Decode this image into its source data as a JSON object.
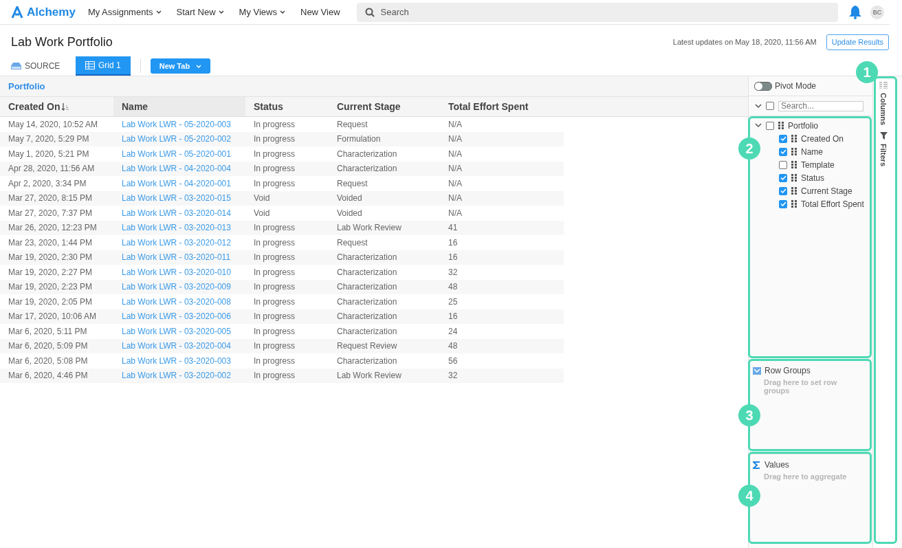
{
  "nav": {
    "logo": "Alchemy",
    "menus": [
      {
        "label": "My Assignments",
        "dropdown": true
      },
      {
        "label": "Start New",
        "dropdown": true
      },
      {
        "label": "My Views",
        "dropdown": true
      },
      {
        "label": "New View",
        "dropdown": false
      }
    ],
    "search": {
      "placeholder": "Search"
    },
    "avatar": "BC"
  },
  "page": {
    "title": "Lab Work Portfolio",
    "updated": "Latest updates on May 18, 2020, 11:56 AM",
    "update_button": "Update Results"
  },
  "tabs": [
    {
      "label": "SOURCE",
      "kind": "source",
      "selected": false
    },
    {
      "label": "Grid 1",
      "kind": "grid",
      "selected": true
    }
  ],
  "new_tab_button": "New Tab",
  "table": {
    "group": "Portfolio",
    "columns": [
      {
        "label": "Created On",
        "sorted": true
      },
      {
        "label": "Name",
        "sorted": false
      },
      {
        "label": "Status",
        "sorted": false
      },
      {
        "label": "Current Stage",
        "sorted": false
      },
      {
        "label": "Total Effort Spent",
        "sorted": false
      }
    ],
    "rows": [
      [
        "May 14, 2020, 10:52 AM",
        "Lab Work LWR - 05-2020-003",
        "In progress",
        "Request",
        "N/A"
      ],
      [
        "May 7, 2020, 5:29 PM",
        "Lab Work LWR - 05-2020-002",
        "In progress",
        "Formulation",
        "N/A"
      ],
      [
        "May 1, 2020, 5:21 PM",
        "Lab Work LWR - 05-2020-001",
        "In progress",
        "Characterization",
        "N/A"
      ],
      [
        "Apr 28, 2020, 11:56 AM",
        "Lab Work LWR - 04-2020-004",
        "In progress",
        "Characterization",
        "N/A"
      ],
      [
        "Apr 2, 2020, 3:34 PM",
        "Lab Work LWR - 04-2020-001",
        "In progress",
        "Request",
        "N/A"
      ],
      [
        "Mar 27, 2020, 8:15 PM",
        "Lab Work LWR - 03-2020-015",
        "Void",
        "Voided",
        "N/A"
      ],
      [
        "Mar 27, 2020, 7:37 PM",
        "Lab Work LWR - 03-2020-014",
        "Void",
        "Voided",
        "N/A"
      ],
      [
        "Mar 26, 2020, 12:23 PM",
        "Lab Work LWR - 03-2020-013",
        "In progress",
        "Lab Work Review",
        "41"
      ],
      [
        "Mar 23, 2020, 1:44 PM",
        "Lab Work LWR - 03-2020-012",
        "In progress",
        "Request",
        "16"
      ],
      [
        "Mar 19, 2020, 2:30 PM",
        "Lab Work LWR - 03-2020-011",
        "In progress",
        "Characterization",
        "16"
      ],
      [
        "Mar 19, 2020, 2:27 PM",
        "Lab Work LWR - 03-2020-010",
        "In progress",
        "Characterization",
        "32"
      ],
      [
        "Mar 19, 2020, 2:23 PM",
        "Lab Work LWR - 03-2020-009",
        "In progress",
        "Characterization",
        "48"
      ],
      [
        "Mar 19, 2020, 2:05 PM",
        "Lab Work LWR - 03-2020-008",
        "In progress",
        "Characterization",
        "25"
      ],
      [
        "Mar 17, 2020, 10:06 AM",
        "Lab Work LWR - 03-2020-006",
        "In progress",
        "Characterization",
        "16"
      ],
      [
        "Mar 6, 2020, 5:11 PM",
        "Lab Work LWR - 03-2020-005",
        "In progress",
        "Characterization",
        "24"
      ],
      [
        "Mar 6, 2020, 5:09 PM",
        "Lab Work LWR - 03-2020-004",
        "In progress",
        "Request Review",
        "48"
      ],
      [
        "Mar 6, 2020, 5:08 PM",
        "Lab Work LWR - 03-2020-003",
        "In progress",
        "Characterization",
        "56"
      ],
      [
        "Mar 6, 2020, 4:46 PM",
        "Lab Work LWR - 03-2020-002",
        "In progress",
        "Lab Work Review",
        "32"
      ]
    ]
  },
  "tool_panel": {
    "pivot_mode": {
      "label": "Pivot Mode",
      "on": false
    },
    "select_all": {
      "checked": false
    },
    "search": {
      "placeholder": "Search..."
    },
    "tree": {
      "label": "Portfolio",
      "checked": false,
      "expanded": true,
      "children": [
        {
          "label": "Created On",
          "checked": true
        },
        {
          "label": "Name",
          "checked": true
        },
        {
          "label": "Template",
          "checked": false
        },
        {
          "label": "Status",
          "checked": true
        },
        {
          "label": "Current Stage",
          "checked": true
        },
        {
          "label": "Total Effort Spent",
          "checked": true
        }
      ]
    },
    "row_groups": {
      "title": "Row Groups",
      "hint": "Drag here to set row groups"
    },
    "values": {
      "title": "Values",
      "hint": "Drag here to aggregate"
    }
  },
  "side_tabs": [
    {
      "label": "Columns",
      "kind": "columns"
    },
    {
      "label": "Filters",
      "kind": "filters"
    }
  ],
  "callouts": [
    {
      "label": "1"
    },
    {
      "label": "2"
    },
    {
      "label": "3"
    },
    {
      "label": "4"
    }
  ]
}
